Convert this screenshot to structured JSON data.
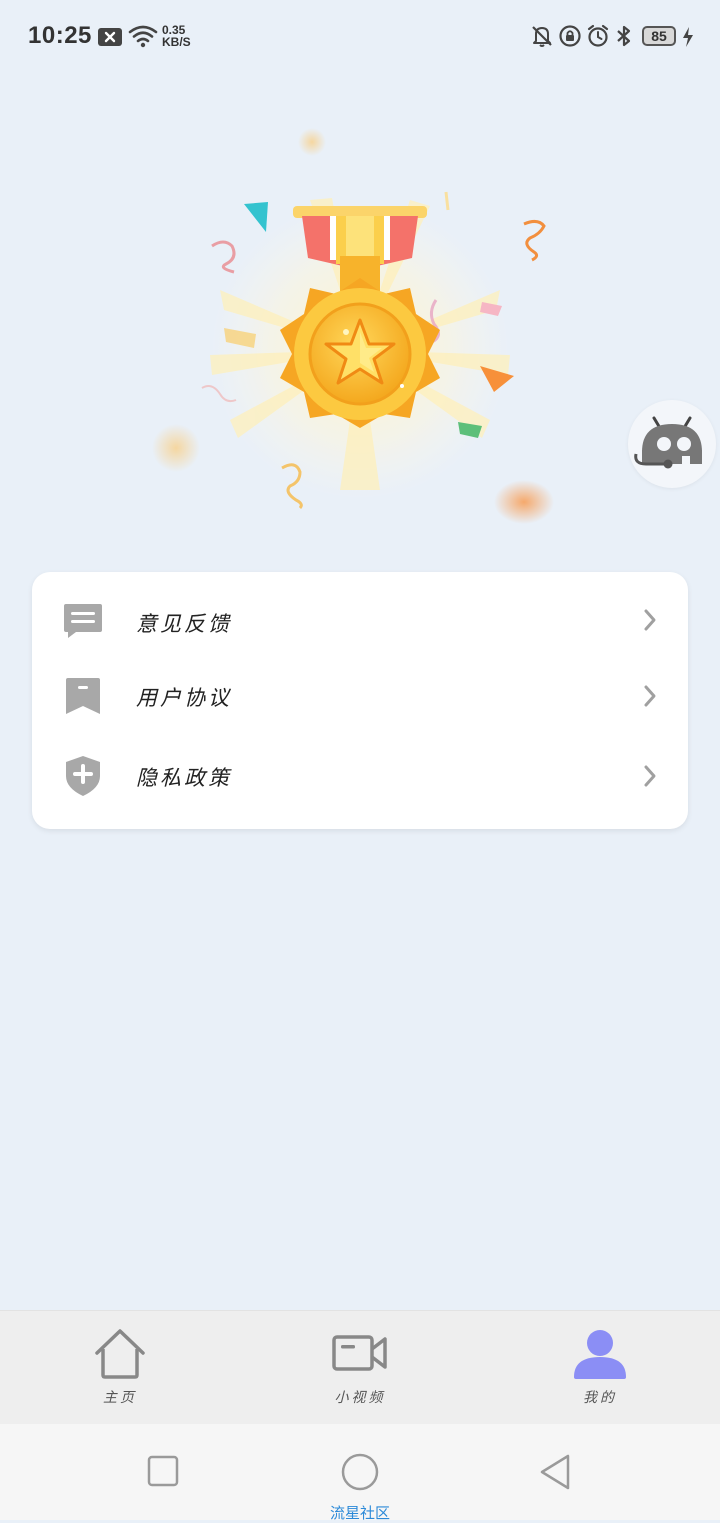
{
  "status_bar": {
    "time": "10:25",
    "net_speed_value": "0.35",
    "net_speed_unit": "KB/S",
    "battery": "85"
  },
  "menu": {
    "items": [
      {
        "label": "意见反馈",
        "icon": "message-icon"
      },
      {
        "label": "用户协议",
        "icon": "bookmark-icon"
      },
      {
        "label": "隐私政策",
        "icon": "shield-plus-icon"
      }
    ]
  },
  "tabs": [
    {
      "label": "主页",
      "icon": "home-icon",
      "active": false
    },
    {
      "label": "小视频",
      "icon": "video-camera-icon",
      "active": false
    },
    {
      "label": "我的",
      "icon": "person-icon",
      "active": true
    }
  ],
  "colors": {
    "background": "#e9f0f8",
    "accent": "#8b8ef5",
    "icon_gray": "#a8a8a8",
    "medal_gold": "#f7b62a",
    "watermark": "#2c8ad8"
  },
  "watermark": "流星社区"
}
